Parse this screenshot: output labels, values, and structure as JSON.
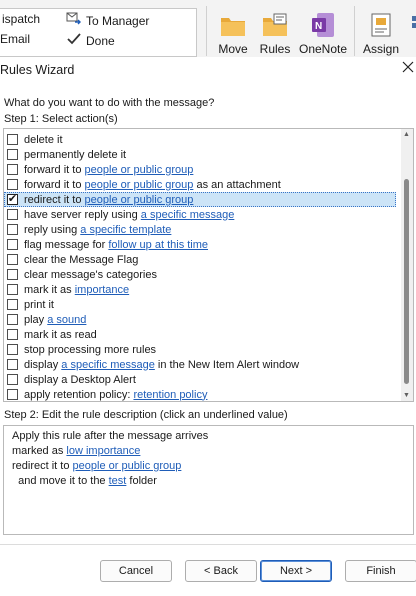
{
  "ribbon": {
    "quick_steps": [
      {
        "label": "ispatch",
        "icon": "dispatch-icon"
      },
      {
        "label": "To Manager",
        "icon": "forward-arrow-icon"
      },
      {
        "label": "Email",
        "icon": "email-icon"
      },
      {
        "label": "Done",
        "icon": "checkmark-icon"
      }
    ],
    "buttons": [
      {
        "label": "Move",
        "icon": "move-folder-icon"
      },
      {
        "label": "Rules",
        "icon": "rules-icon"
      },
      {
        "label": "OneNote",
        "icon": "onenote-icon"
      },
      {
        "label": "Assign",
        "icon": "assign-policy-icon"
      }
    ]
  },
  "dialog": {
    "title": "Rules Wizard",
    "question": "What do you want to do with the message?",
    "step1_label": "Step 1: Select action(s)",
    "actions": [
      {
        "parts": [
          {
            "t": "delete it"
          }
        ],
        "checked": false
      },
      {
        "parts": [
          {
            "t": "permanently delete it"
          }
        ],
        "checked": false
      },
      {
        "parts": [
          {
            "t": "forward it to "
          },
          {
            "t": "people or public group",
            "link": true
          }
        ],
        "checked": false
      },
      {
        "parts": [
          {
            "t": "forward it to "
          },
          {
            "t": "people or public group",
            "link": true
          },
          {
            "t": " as an attachment"
          }
        ],
        "checked": false
      },
      {
        "parts": [
          {
            "t": "redirect it to "
          },
          {
            "t": "people or public group",
            "link": true
          }
        ],
        "checked": true,
        "selected": true
      },
      {
        "parts": [
          {
            "t": "have server reply using "
          },
          {
            "t": "a specific message",
            "link": true
          }
        ],
        "checked": false
      },
      {
        "parts": [
          {
            "t": "reply using "
          },
          {
            "t": "a specific template",
            "link": true
          }
        ],
        "checked": false
      },
      {
        "parts": [
          {
            "t": "flag message for "
          },
          {
            "t": "follow up at this time",
            "link": true
          }
        ],
        "checked": false
      },
      {
        "parts": [
          {
            "t": "clear the Message Flag"
          }
        ],
        "checked": false
      },
      {
        "parts": [
          {
            "t": "clear message's categories"
          }
        ],
        "checked": false
      },
      {
        "parts": [
          {
            "t": "mark it as "
          },
          {
            "t": "importance",
            "link": true
          }
        ],
        "checked": false
      },
      {
        "parts": [
          {
            "t": "print it"
          }
        ],
        "checked": false
      },
      {
        "parts": [
          {
            "t": "play "
          },
          {
            "t": "a sound",
            "link": true
          }
        ],
        "checked": false
      },
      {
        "parts": [
          {
            "t": "mark it as read"
          }
        ],
        "checked": false
      },
      {
        "parts": [
          {
            "t": "stop processing more rules"
          }
        ],
        "checked": false
      },
      {
        "parts": [
          {
            "t": "display "
          },
          {
            "t": "a specific message",
            "link": true
          },
          {
            "t": " in the New Item Alert window"
          }
        ],
        "checked": false
      },
      {
        "parts": [
          {
            "t": "display a Desktop Alert"
          }
        ],
        "checked": false
      },
      {
        "parts": [
          {
            "t": "apply retention policy: "
          },
          {
            "t": "retention policy",
            "link": true
          }
        ],
        "checked": false
      }
    ],
    "step2_label": "Step 2: Edit the rule description (click an underlined value)",
    "description": [
      [
        {
          "t": "Apply this rule after the message arrives"
        }
      ],
      [
        {
          "t": "marked as "
        },
        {
          "t": "low importance",
          "link": true
        }
      ],
      [
        {
          "t": "redirect it to "
        },
        {
          "t": "people or public group",
          "link": true
        }
      ],
      [
        {
          "t": "  and move it to the "
        },
        {
          "t": "test",
          "link": true
        },
        {
          "t": " folder"
        }
      ]
    ],
    "buttons": {
      "cancel": "Cancel",
      "back": "< Back",
      "next": "Next >",
      "finish": "Finish"
    }
  },
  "colors": {
    "link": "#1f5db8",
    "selection": "#cce4f7",
    "onenote": "#7a3aa6",
    "folder": "#e8a93a"
  }
}
